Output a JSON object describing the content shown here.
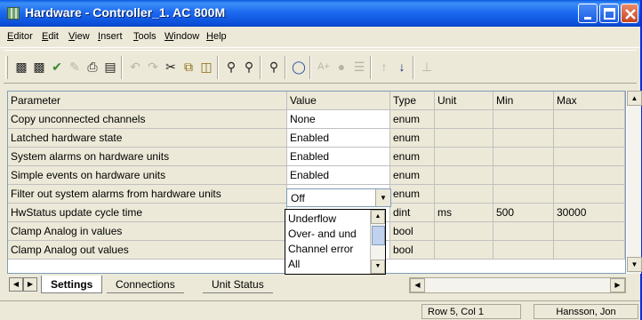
{
  "window": {
    "title": "Hardware - Controller_1. AC 800M"
  },
  "menu": [
    "Editor",
    "Edit",
    "View",
    "Insert",
    "Tools",
    "Window",
    "Help"
  ],
  "toolbar_icons": [
    "save-icon",
    "save-all-icon",
    "check-icon",
    "edit-icon",
    "print-icon",
    "print-preview-icon",
    "undo-icon",
    "redo-icon",
    "cut-icon",
    "copy-icon",
    "paste-icon",
    "find-icon",
    "find-replace-icon",
    "navigate-icon",
    "shield-icon",
    "insert-icon",
    "connect-icon",
    "tree-icon",
    "up-arrow-icon",
    "down-arrow-icon",
    "ground-icon"
  ],
  "table": {
    "headers": [
      "Parameter",
      "Value",
      "Type",
      "Unit",
      "Min",
      "Max"
    ],
    "rows": [
      [
        "Copy unconnected channels",
        "None",
        "enum",
        "",
        "",
        ""
      ],
      [
        "Latched hardware state",
        "Enabled",
        "enum",
        "",
        "",
        ""
      ],
      [
        "System alarms on hardware units",
        "Enabled",
        "enum",
        "",
        "",
        ""
      ],
      [
        "Simple events on hardware units",
        "Enabled",
        "enum",
        "",
        "",
        ""
      ],
      [
        "Filter out system alarms from hardware units",
        "Off",
        "enum",
        "",
        "",
        ""
      ],
      [
        "HwStatus update cycle time",
        "",
        "dint",
        "ms",
        "500",
        "30000"
      ],
      [
        "Clamp Analog in values",
        "",
        "bool",
        "",
        "",
        ""
      ],
      [
        "Clamp Analog out values",
        "",
        "bool",
        "",
        "",
        ""
      ]
    ]
  },
  "dropdown": {
    "selected": "Off",
    "options": [
      "Underflow",
      "Over- and und",
      "Channel error",
      "All"
    ]
  },
  "tabs": [
    "Settings",
    "Connections",
    "Unit Status"
  ],
  "status": {
    "position": "Row 5, Col 1",
    "user": "Hansson, Jon"
  }
}
